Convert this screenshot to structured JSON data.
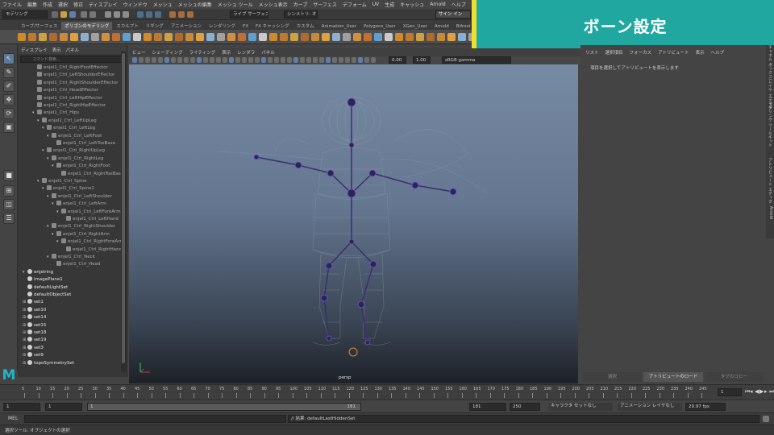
{
  "banner": {
    "title": "ボーン設定"
  },
  "menu": [
    "ファイル",
    "編集",
    "作成",
    "選択",
    "修正",
    "ディスプレイ",
    "ウィンドウ",
    "メッシュ",
    "メッシュの編集",
    "メッシュ ツール",
    "メッシュ表示",
    "カーブ",
    "サーフェス",
    "デフォーム",
    "UV",
    "生成",
    "キャッシュ",
    "Arnold",
    "ヘルプ"
  ],
  "status": {
    "mode": "モデリング",
    "live": "ライブ サーフェスなし",
    "symmetry": "シンメトリ: オフ",
    "signin": "サイン イン"
  },
  "shelf_tabs": [
    "カーブ/サーフェス",
    "ポリゴンのモデリング",
    "スカルプト",
    "リギング",
    "アニメーション",
    "レンダリング",
    "FX",
    "FX キャッシング",
    "カスタム",
    "Animation_User",
    "Polygons_User",
    "XGen_User",
    "Arnold",
    "Bifrost"
  ],
  "shelf_tab_active": 1,
  "outliner": {
    "menu": [
      "ディスプレイ",
      "表示",
      "パネル"
    ],
    "search_placeholder": "コマンド検索...",
    "items": [
      "enjel1_Ctrl_RightFootEffector",
      "enjel1_Ctrl_LeftShoulderEffector",
      "enjel1_Ctrl_RightShoulderEffector",
      "enjel1_Ctrl_HeadEffector",
      "enjel1_Ctrl_LeftHipEffector",
      "enjel1_Ctrl_RightHipEffector",
      "enjel1_Ctrl_Hips",
      "enjel1_Ctrl_LeftUpLeg",
      "enjel1_Ctrl_LeftLeg",
      "enjel1_Ctrl_LeftFoot",
      "enjel1_Ctrl_LeftToeBase",
      "enjel1_Ctrl_RightUpLeg",
      "enjel1_Ctrl_RightLeg",
      "enjel1_Ctrl_RightFoot",
      "enjel1_Ctrl_RightToeBase",
      "enjel1_Ctrl_Spine",
      "enjel1_Ctrl_Spine1",
      "enjel1_Ctrl_LeftShoulder",
      "enjel1_Ctrl_LeftArm",
      "enjel1_Ctrl_LeftForeArm",
      "enjel1_Ctrl_LeftHand",
      "enjel1_Ctrl_RightShoulder",
      "enjel1_Ctrl_RightArm",
      "enjel1_Ctrl_RightForeArm",
      "enjel1_Ctrl_RightHand",
      "enjel1_Ctrl_Neck",
      "enjel1_Ctrl_Head",
      "enjelring",
      "imagePlane1",
      "defaultLightSet",
      "defaultObjectSet",
      "set1",
      "set10",
      "set14",
      "set15",
      "set18",
      "set19",
      "set3",
      "set9",
      "topoSymmetrySet"
    ]
  },
  "viewport": {
    "menu": [
      "ビュー",
      "シェーディング",
      "ライティング",
      "表示",
      "レンダラ",
      "パネル"
    ],
    "camera": "persp",
    "toolbar_value1": "0.00",
    "toolbar_value2": "1.00",
    "color_space": "sRGB gamma"
  },
  "attribute_editor": {
    "menu": [
      "リスト",
      "選択項目",
      "フォーカス",
      "アトリビュート",
      "表示",
      "ヘルプ"
    ],
    "message": "項目を選択してアトリビュートを表示します",
    "bottom": [
      "選択",
      "アトリビュートのロード",
      "タグのコピー"
    ]
  },
  "side_tabs": [
    "チャネル ボックス/レイヤ エディタ",
    "モデリング ツールキット",
    "アトリビュート エディタ",
    "Arnold"
  ],
  "timeline": {
    "ticks": [
      "5",
      "10",
      "15",
      "20",
      "25",
      "30",
      "35",
      "40",
      "45",
      "50",
      "55",
      "60",
      "65",
      "70",
      "75",
      "80",
      "85",
      "90",
      "95",
      "100",
      "105",
      "110",
      "115",
      "120",
      "125",
      "130",
      "135",
      "140",
      "145",
      "150",
      "155",
      "160",
      "165",
      "170",
      "175",
      "180",
      "185",
      "190",
      "195",
      "200",
      "205",
      "210",
      "215",
      "220",
      "225",
      "230",
      "235",
      "240",
      "245"
    ],
    "current": "1"
  },
  "range": {
    "start": "1",
    "start2": "1",
    "slider_left": "1",
    "slider_right": "181",
    "end": "181",
    "end2": "250",
    "character": "キャラクタ セットなし",
    "anim_layer": "アニメーション レイヤなし",
    "fps": "29.97 fps"
  },
  "mel": {
    "label": "MEL",
    "result": "// 結果: defaultLastHiddenSet"
  },
  "helpline": "選択ツール: オブジェクトの選択"
}
